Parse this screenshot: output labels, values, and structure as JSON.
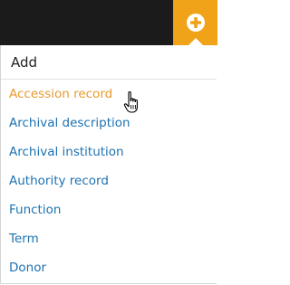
{
  "topbar": {
    "add_button": {
      "icon": "plus-circle-icon",
      "accent": "#f0a219"
    }
  },
  "menu": {
    "header": "Add",
    "items": [
      {
        "label": "Accession record",
        "active": true
      },
      {
        "label": "Archival description",
        "active": false
      },
      {
        "label": "Archival institution",
        "active": false
      },
      {
        "label": "Authority record",
        "active": false
      },
      {
        "label": "Function",
        "active": false
      },
      {
        "label": "Term",
        "active": false
      },
      {
        "label": "Donor",
        "active": false
      }
    ],
    "link_color": "#1d72b2",
    "hover_color": "#e79a2c"
  },
  "cursor": {
    "icon": "hand-pointer-icon"
  }
}
